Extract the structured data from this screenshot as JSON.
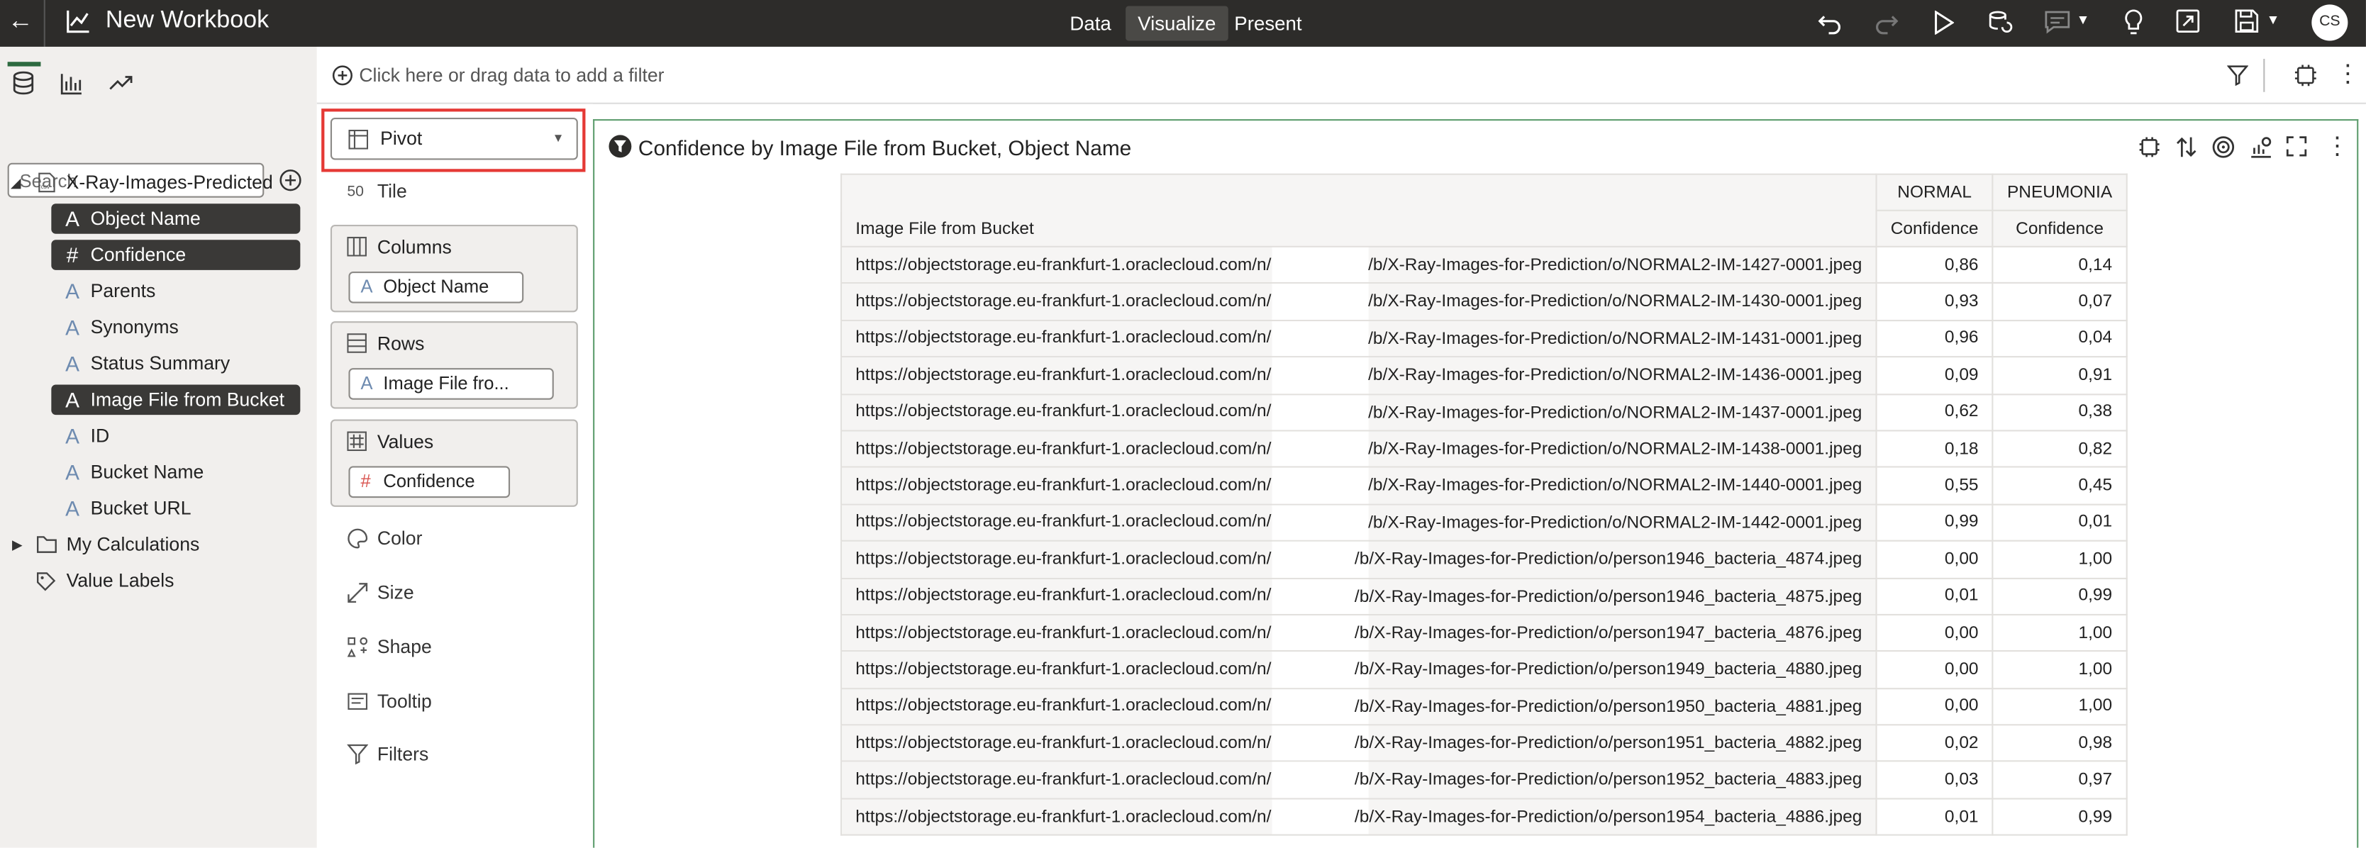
{
  "topbar": {
    "title": "New Workbook",
    "tabs": [
      "Data",
      "Visualize",
      "Present"
    ],
    "active_tab": "Visualize",
    "avatar": "CS"
  },
  "left_panel": {
    "search_placeholder": "Search",
    "dataset": "X-Ray-Images-Predicted",
    "fields": [
      {
        "label": "Object Name",
        "type": "attribute",
        "selected": true
      },
      {
        "label": "Confidence",
        "type": "measure",
        "selected": true
      },
      {
        "label": "Parents",
        "type": "attribute",
        "selected": false
      },
      {
        "label": "Synonyms",
        "type": "attribute",
        "selected": false
      },
      {
        "label": "Status Summary",
        "type": "attribute",
        "selected": false
      },
      {
        "label": "Image File from Bucket",
        "type": "attribute",
        "selected": true
      },
      {
        "label": "ID",
        "type": "attribute",
        "selected": false
      },
      {
        "label": "Bucket Name",
        "type": "attribute",
        "selected": false
      },
      {
        "label": "Bucket URL",
        "type": "attribute",
        "selected": false
      }
    ],
    "my_calculations": "My Calculations",
    "value_labels": "Value Labels"
  },
  "filter_bar": {
    "placeholder": "Click here or drag data to add a filter"
  },
  "grammar": {
    "viz_type": "Pivot",
    "tile": "Tile",
    "columns": {
      "label": "Columns",
      "pill": "Object Name"
    },
    "rows": {
      "label": "Rows",
      "pill": "Image File fro..."
    },
    "values": {
      "label": "Values",
      "pill": "Confidence"
    },
    "color": "Color",
    "size": "Size",
    "shape": "Shape",
    "tooltip": "Tooltip",
    "filters": "Filters"
  },
  "viz": {
    "title": "Confidence by Image File from Bucket, Object Name",
    "row_header": "Image File from Bucket",
    "col_groups": [
      "NORMAL",
      "PNEUMONIA"
    ],
    "measure": "Confidence",
    "url_prefix": "https://objectstorage.eu-frankfurt-1.oraclecloud.com/n/",
    "rows": [
      {
        "suffix": "/b/X-Ray-Images-for-Prediction/o/NORMAL2-IM-1427-0001.jpeg",
        "normal": "0,86",
        "pneumonia": "0,14"
      },
      {
        "suffix": "/b/X-Ray-Images-for-Prediction/o/NORMAL2-IM-1430-0001.jpeg",
        "normal": "0,93",
        "pneumonia": "0,07"
      },
      {
        "suffix": "/b/X-Ray-Images-for-Prediction/o/NORMAL2-IM-1431-0001.jpeg",
        "normal": "0,96",
        "pneumonia": "0,04"
      },
      {
        "suffix": "/b/X-Ray-Images-for-Prediction/o/NORMAL2-IM-1436-0001.jpeg",
        "normal": "0,09",
        "pneumonia": "0,91"
      },
      {
        "suffix": "/b/X-Ray-Images-for-Prediction/o/NORMAL2-IM-1437-0001.jpeg",
        "normal": "0,62",
        "pneumonia": "0,38"
      },
      {
        "suffix": "/b/X-Ray-Images-for-Prediction/o/NORMAL2-IM-1438-0001.jpeg",
        "normal": "0,18",
        "pneumonia": "0,82"
      },
      {
        "suffix": "/b/X-Ray-Images-for-Prediction/o/NORMAL2-IM-1440-0001.jpeg",
        "normal": "0,55",
        "pneumonia": "0,45"
      },
      {
        "suffix": "/b/X-Ray-Images-for-Prediction/o/NORMAL2-IM-1442-0001.jpeg",
        "normal": "0,99",
        "pneumonia": "0,01"
      },
      {
        "suffix": "/b/X-Ray-Images-for-Prediction/o/person1946_bacteria_4874.jpeg",
        "normal": "0,00",
        "pneumonia": "1,00"
      },
      {
        "suffix": "/b/X-Ray-Images-for-Prediction/o/person1946_bacteria_4875.jpeg",
        "normal": "0,01",
        "pneumonia": "0,99"
      },
      {
        "suffix": "/b/X-Ray-Images-for-Prediction/o/person1947_bacteria_4876.jpeg",
        "normal": "0,00",
        "pneumonia": "1,00"
      },
      {
        "suffix": "/b/X-Ray-Images-for-Prediction/o/person1949_bacteria_4880.jpeg",
        "normal": "0,00",
        "pneumonia": "1,00"
      },
      {
        "suffix": "/b/X-Ray-Images-for-Prediction/o/person1950_bacteria_4881.jpeg",
        "normal": "0,00",
        "pneumonia": "1,00"
      },
      {
        "suffix": "/b/X-Ray-Images-for-Prediction/o/person1951_bacteria_4882.jpeg",
        "normal": "0,02",
        "pneumonia": "0,98"
      },
      {
        "suffix": "/b/X-Ray-Images-for-Prediction/o/person1952_bacteria_4883.jpeg",
        "normal": "0,03",
        "pneumonia": "0,97"
      },
      {
        "suffix": "/b/X-Ray-Images-for-Prediction/o/person1954_bacteria_4886.jpeg",
        "normal": "0,01",
        "pneumonia": "0,99"
      }
    ]
  },
  "colors": {
    "topbar": "#2d2c2a",
    "panel": "#f1efed",
    "selected_field": "#3a3937",
    "canvas_border": "#5f9e6f",
    "highlight": "#e53935"
  }
}
